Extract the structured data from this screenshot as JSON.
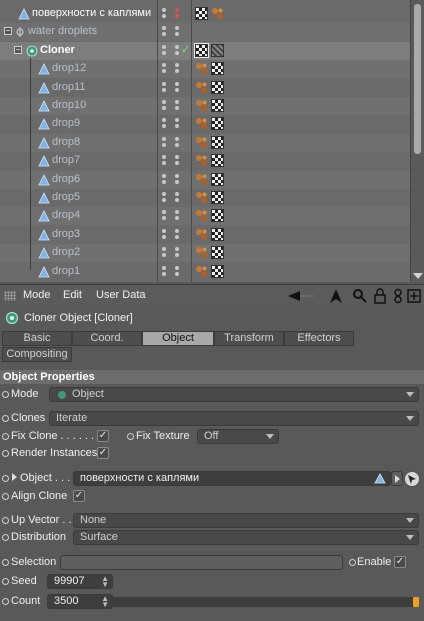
{
  "tree": {
    "rows": [
      {
        "label": "поверхности с каплями",
        "style": "light",
        "indent": 18,
        "icon": "polygon-object-icon",
        "dots_red": true,
        "tags": [
          "checker",
          "spheres"
        ]
      },
      {
        "label": "water droplets",
        "style": "dim",
        "indent": 14,
        "icon": "null-object-icon",
        "dots_red": false,
        "tags": []
      },
      {
        "label": "Cloner",
        "style": "bold",
        "indent": 26,
        "icon": "cloner-icon",
        "dots_red": false,
        "tags": [
          "checker-selected",
          "noise"
        ],
        "selected": true
      },
      {
        "label": "drop12",
        "style": "dim",
        "indent": 38,
        "icon": "sphere-object-icon",
        "tags": [
          "spheres",
          "checker"
        ]
      },
      {
        "label": "drop11",
        "style": "dim",
        "indent": 38,
        "icon": "sphere-object-icon",
        "tags": [
          "spheres",
          "checker"
        ]
      },
      {
        "label": "drop10",
        "style": "dim",
        "indent": 38,
        "icon": "sphere-object-icon",
        "tags": [
          "spheres",
          "checker"
        ]
      },
      {
        "label": "drop9",
        "style": "dim",
        "indent": 38,
        "icon": "sphere-object-icon",
        "tags": [
          "spheres",
          "checker"
        ]
      },
      {
        "label": "drop8",
        "style": "dim",
        "indent": 38,
        "icon": "sphere-object-icon",
        "tags": [
          "spheres",
          "checker"
        ]
      },
      {
        "label": "drop7",
        "style": "dim",
        "indent": 38,
        "icon": "sphere-object-icon",
        "tags": [
          "spheres",
          "checker"
        ]
      },
      {
        "label": "drop6",
        "style": "dim",
        "indent": 38,
        "icon": "sphere-object-icon",
        "tags": [
          "spheres",
          "checker"
        ]
      },
      {
        "label": "drop5",
        "style": "dim",
        "indent": 38,
        "icon": "sphere-object-icon",
        "tags": [
          "spheres",
          "checker"
        ]
      },
      {
        "label": "drop4",
        "style": "dim",
        "indent": 38,
        "icon": "sphere-object-icon",
        "tags": [
          "spheres",
          "checker"
        ]
      },
      {
        "label": "drop3",
        "style": "dim",
        "indent": 38,
        "icon": "sphere-object-icon",
        "tags": [
          "spheres",
          "checker"
        ]
      },
      {
        "label": "drop2",
        "style": "dim",
        "indent": 38,
        "icon": "sphere-object-icon",
        "tags": [
          "spheres",
          "checker"
        ]
      },
      {
        "label": "drop1",
        "style": "dim",
        "indent": 38,
        "icon": "sphere-object-icon",
        "tags": [
          "spheres",
          "checker"
        ]
      }
    ]
  },
  "menubar": {
    "items": [
      "Mode",
      "Edit",
      "User Data"
    ],
    "icons": [
      "back-arrow-icon",
      "cursor-icon",
      "search-icon",
      "lock-icon",
      "link-icon",
      "new-panel-icon"
    ]
  },
  "object": {
    "title": "Cloner Object [Cloner]"
  },
  "tabs": {
    "row1": [
      "Basic",
      "Coord.",
      "Object",
      "Transform",
      "Effectors"
    ],
    "row2": [
      "Compositing"
    ],
    "active": "Object"
  },
  "section": {
    "title": "Object Properties"
  },
  "props": {
    "mode_label": "Mode",
    "mode_value": "Object",
    "clones_label": "Clones",
    "clones_value": "Iterate",
    "fix_clone_label": "Fix Clone . . . . . .",
    "fix_clone_checked": "✓",
    "fix_texture_label": "Fix Texture",
    "fix_texture_value": "Off",
    "render_instances_label": "Render Instances",
    "render_instances_checked": "✓",
    "object_label": "Object . . .",
    "object_value": "поверхности с каплями",
    "align_clone_label": "Align Clone",
    "align_clone_checked": "✓",
    "up_vector_label": "Up Vector . .",
    "up_vector_value": "None",
    "distribution_label": "Distribution",
    "distribution_value": "Surface",
    "selection_label": "Selection",
    "enable_label": "Enable",
    "enable_checked": "✓",
    "seed_label": "Seed",
    "seed_value": "99907",
    "count_label": "Count",
    "count_value": "3500"
  },
  "colors": {
    "panel_bg": "#595959",
    "tree_bg": "#6a6a6a",
    "active_tab": "#a8a8a8",
    "slider_accent": "#f0a020"
  }
}
